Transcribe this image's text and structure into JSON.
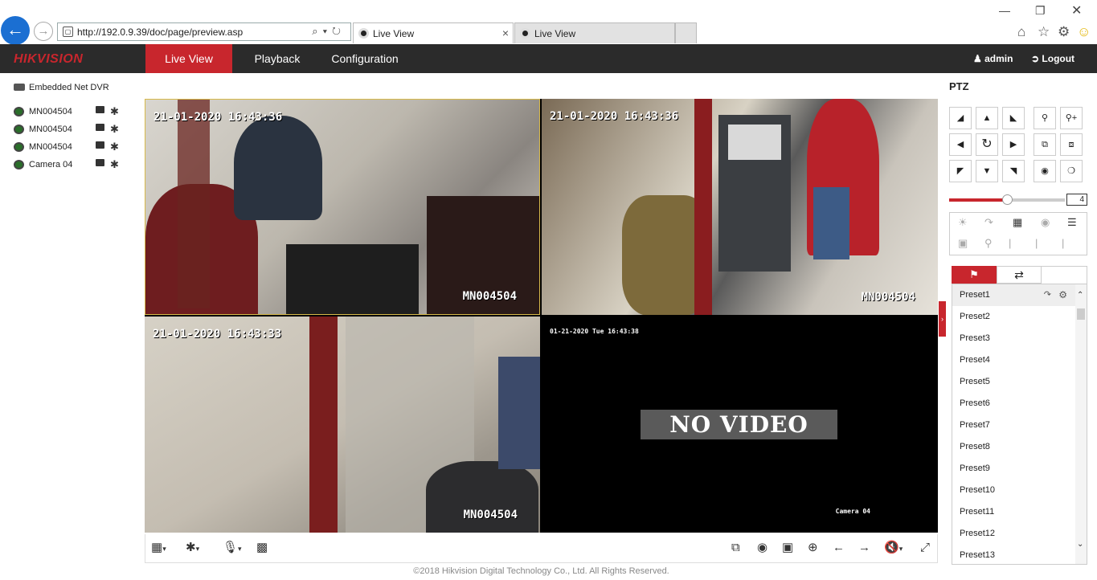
{
  "browser": {
    "url": "http://192.0.9.39/doc/page/preview.asp",
    "tabs": [
      {
        "title": "Live View"
      },
      {
        "title": "Live View"
      }
    ]
  },
  "app": {
    "logo": "HIKVISION",
    "menu": [
      "Live View",
      "Playback",
      "Configuration"
    ],
    "active_menu": "Live View",
    "user": "admin",
    "logout": "Logout",
    "accent": "#c8262d"
  },
  "tree": {
    "root": "Embedded Net DVR",
    "channels": [
      "MN004504",
      "MN004504",
      "MN004504",
      "Camera 04"
    ]
  },
  "viewports": [
    {
      "timestamp": "21-01-2020 16:43:36",
      "camera_name": "MN004504"
    },
    {
      "timestamp": "21-01-2020 16:43:36",
      "camera_name": "MN004504"
    },
    {
      "timestamp": "21-01-2020 16:43:33",
      "camera_name": "MN004504"
    },
    {
      "timestamp": "01-21-2020 Tue 16:43:38",
      "camera_name": "Camera 04",
      "no_video": "NO VIDEO"
    }
  ],
  "ptz": {
    "title": "PTZ",
    "speed": "4",
    "speed_level": 0.5,
    "presets": [
      "Preset1",
      "Preset2",
      "Preset3",
      "Preset4",
      "Preset5",
      "Preset6",
      "Preset7",
      "Preset8",
      "Preset9",
      "Preset10",
      "Preset11",
      "Preset12",
      "Preset13"
    ]
  },
  "footer": "©2018 Hikvision Digital Technology Co., Ltd. All Rights Reserved."
}
